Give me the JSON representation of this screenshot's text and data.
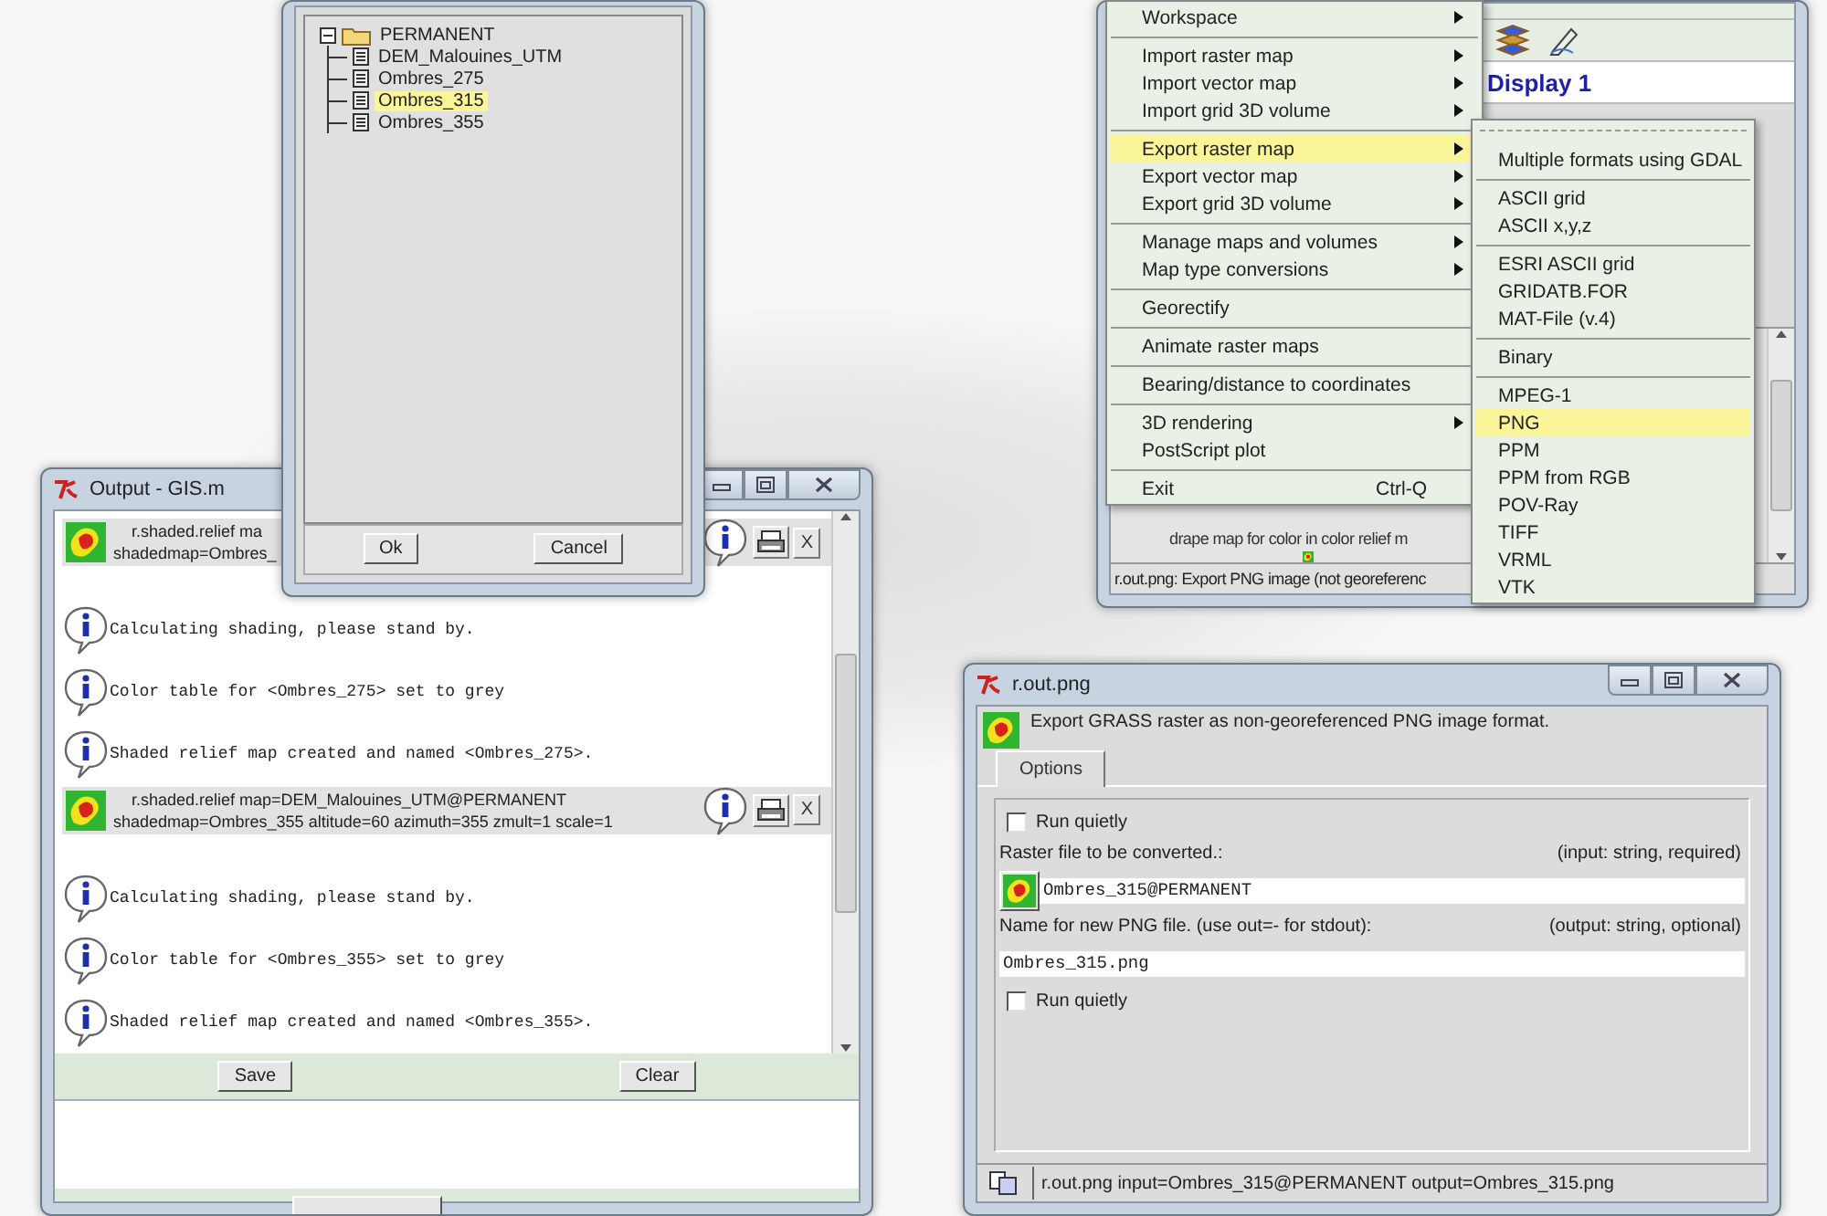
{
  "select_dialog": {
    "tree": [
      {
        "label": "PERMANENT",
        "expanded": true,
        "selected": false,
        "children": [
          {
            "label": "DEM_Malouines_UTM",
            "selected": false
          },
          {
            "label": "Ombres_275",
            "selected": false
          },
          {
            "label": "Ombres_315",
            "selected": true
          },
          {
            "label": "Ombres_355",
            "selected": false
          }
        ]
      }
    ],
    "buttons": [
      "Ok",
      "Cancel"
    ]
  },
  "output_window": {
    "title": "Output - GIS.m",
    "entries": [
      {
        "kind": "command",
        "lines": [
          "r.shaded.relief ma",
          "shadedmap=Ombres_"
        ],
        "close": "X"
      },
      {
        "kind": "info",
        "text": "Calculating shading, please stand by."
      },
      {
        "kind": "info",
        "text": "Color table for <Ombres_275> set to grey"
      },
      {
        "kind": "info",
        "text": "Shaded relief map created and named <Ombres_275>."
      },
      {
        "kind": "command",
        "lines": [
          "r.shaded.relief map=DEM_Malouines_UTM@PERMANENT",
          "shadedmap=Ombres_355 altitude=60 azimuth=355 zmult=1 scale=1"
        ],
        "close": "X"
      },
      {
        "kind": "info",
        "text": "Calculating shading, please stand by."
      },
      {
        "kind": "info",
        "text": "Color table for <Ombres_355> set to grey"
      },
      {
        "kind": "info",
        "text": "Shaded relief map created and named <Ombres_355>."
      }
    ],
    "buttons": [
      "Save",
      "Clear"
    ]
  },
  "gis_manager": {
    "display_tab": "Display 1",
    "help_text": "drape map for color in color relief m",
    "status_bar": "r.out.png: Export PNG image (not georeferenc"
  },
  "file_menu": {
    "items": [
      {
        "kind": "item",
        "label": "Workspace",
        "submenu": true,
        "selected": false
      },
      {
        "kind": "separator"
      },
      {
        "kind": "item",
        "label": "Import raster map",
        "submenu": true,
        "selected": false
      },
      {
        "kind": "item",
        "label": "Import vector map",
        "submenu": true,
        "selected": false
      },
      {
        "kind": "item",
        "label": "Import grid 3D volume",
        "submenu": true,
        "selected": false
      },
      {
        "kind": "separator"
      },
      {
        "kind": "item",
        "label": "Export raster map",
        "submenu": true,
        "selected": true
      },
      {
        "kind": "item",
        "label": "Export vector map",
        "submenu": true,
        "selected": false
      },
      {
        "kind": "item",
        "label": "Export grid 3D volume",
        "submenu": true,
        "selected": false
      },
      {
        "kind": "separator"
      },
      {
        "kind": "item",
        "label": "Manage maps and volumes",
        "submenu": true,
        "selected": false
      },
      {
        "kind": "item",
        "label": "Map type conversions",
        "submenu": true,
        "selected": false
      },
      {
        "kind": "separator"
      },
      {
        "kind": "item",
        "label": "Georectify",
        "submenu": false,
        "selected": false
      },
      {
        "kind": "separator"
      },
      {
        "kind": "item",
        "label": "Animate raster maps",
        "submenu": false,
        "selected": false
      },
      {
        "kind": "separator"
      },
      {
        "kind": "item",
        "label": "Bearing/distance to coordinates",
        "submenu": false,
        "selected": false
      },
      {
        "kind": "separator"
      },
      {
        "kind": "item",
        "label": "3D rendering",
        "submenu": true,
        "selected": false
      },
      {
        "kind": "item",
        "label": "PostScript plot",
        "submenu": false,
        "selected": false
      },
      {
        "kind": "separator"
      },
      {
        "kind": "item",
        "label": "Exit",
        "shortcut": "Ctrl-Q",
        "submenu": false,
        "selected": false
      }
    ]
  },
  "export_submenu": {
    "items": [
      {
        "kind": "tearoff"
      },
      {
        "kind": "item",
        "label": "Multiple formats using GDAL",
        "selected": false
      },
      {
        "kind": "separator"
      },
      {
        "kind": "item",
        "label": "ASCII grid",
        "selected": false
      },
      {
        "kind": "item",
        "label": "ASCII x,y,z",
        "selected": false
      },
      {
        "kind": "separator"
      },
      {
        "kind": "item",
        "label": "ESRI ASCII grid",
        "selected": false
      },
      {
        "kind": "item",
        "label": "GRIDATB.FOR",
        "selected": false
      },
      {
        "kind": "item",
        "label": "MAT-File (v.4)",
        "selected": false
      },
      {
        "kind": "separator"
      },
      {
        "kind": "item",
        "label": "Binary",
        "selected": false
      },
      {
        "kind": "separator"
      },
      {
        "kind": "item",
        "label": "MPEG-1",
        "selected": false
      },
      {
        "kind": "item",
        "label": "PNG",
        "selected": true
      },
      {
        "kind": "item",
        "label": "PPM",
        "selected": false
      },
      {
        "kind": "item",
        "label": "PPM from RGB",
        "selected": false
      },
      {
        "kind": "item",
        "label": "POV-Ray",
        "selected": false
      },
      {
        "kind": "item",
        "label": "TIFF",
        "selected": false
      },
      {
        "kind": "item",
        "label": "VRML",
        "selected": false
      },
      {
        "kind": "item",
        "label": "VTK",
        "selected": false
      }
    ]
  },
  "r_out_png": {
    "title": "r.out.png",
    "description": "Export GRASS raster as non-georeferenced PNG image format.",
    "tabs": [
      {
        "label": "Options",
        "selected": true
      }
    ],
    "options": [
      {
        "kind": "checkbox",
        "label": "Run quietly",
        "checked": false
      },
      {
        "kind": "map_field",
        "label": "Raster file to be converted.:",
        "hint": "(input: string, required)",
        "value": "Ombres_315@PERMANENT"
      },
      {
        "kind": "text_field",
        "label": "Name for new PNG file. (use out=- for stdout):",
        "hint": "(output: string, optional)",
        "value": "Ombres_315.png"
      },
      {
        "kind": "checkbox",
        "label": "Run quietly",
        "checked": false
      }
    ],
    "command": "r.out.png input=Ombres_315@PERMANENT output=Ombres_315.png"
  }
}
